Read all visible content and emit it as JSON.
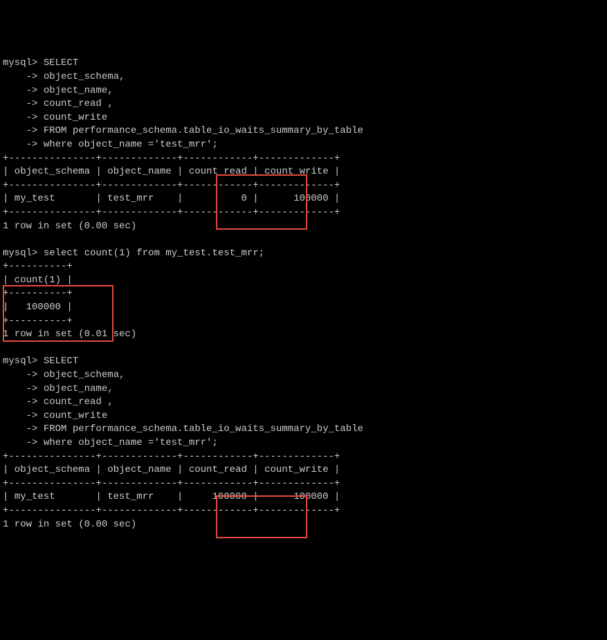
{
  "prompt_main": "mysql> ",
  "prompt_cont": "    -> ",
  "query1": {
    "lines": [
      "SELECT",
      "object_schema,",
      "object_name,",
      "count_read ,",
      "count_write",
      "FROM performance_schema.table_io_waits_summary_by_table",
      "where object_name ='test_mrr';"
    ]
  },
  "table1": {
    "border_top": "+---------------+-------------+------------+-------------+",
    "header": "| object_schema | object_name | count_read | count_write |",
    "border_mid": "+---------------+-------------+------------+-------------+",
    "row": "| my_test       | test_mrr    |          0 |      100000 |",
    "border_bottom": "+---------------+-------------+------------+-------------+",
    "status": "1 row in set (0.00 sec)"
  },
  "query2": {
    "line": "select count(1) from my_test.test_mrr;"
  },
  "table2": {
    "border_top": "+----------+",
    "header": "| count(1) |",
    "border_mid": "+----------+",
    "row": "|   100000 |",
    "border_bottom": "+----------+",
    "status": "1 row in set (0.01 sec)"
  },
  "query3": {
    "lines": [
      "SELECT",
      "object_schema,",
      "object_name,",
      "count_read ,",
      "count_write",
      "FROM performance_schema.table_io_waits_summary_by_table",
      "where object_name ='test_mrr';"
    ]
  },
  "table3": {
    "border_top": "+---------------+-------------+------------+-------------+",
    "header": "| object_schema | object_name | count_read | count_write |",
    "border_mid": "+---------------+-------------+------------+-------------+",
    "row": "| my_test       | test_mrr    |     100000 |      100000 |",
    "border_bottom": "+---------------+-------------+------------+-------------+",
    "status": "1 row in set (0.00 sec)"
  },
  "chart_data": {
    "type": "table",
    "tables": [
      {
        "title": "performance_schema.table_io_waits_summary_by_table (before count)",
        "columns": [
          "object_schema",
          "object_name",
          "count_read",
          "count_write"
        ],
        "rows": [
          [
            "my_test",
            "test_mrr",
            0,
            100000
          ]
        ]
      },
      {
        "title": "select count(1) from my_test.test_mrr",
        "columns": [
          "count(1)"
        ],
        "rows": [
          [
            100000
          ]
        ]
      },
      {
        "title": "performance_schema.table_io_waits_summary_by_table (after count)",
        "columns": [
          "object_schema",
          "object_name",
          "count_read",
          "count_write"
        ],
        "rows": [
          [
            "my_test",
            "test_mrr",
            100000,
            100000
          ]
        ]
      }
    ]
  }
}
